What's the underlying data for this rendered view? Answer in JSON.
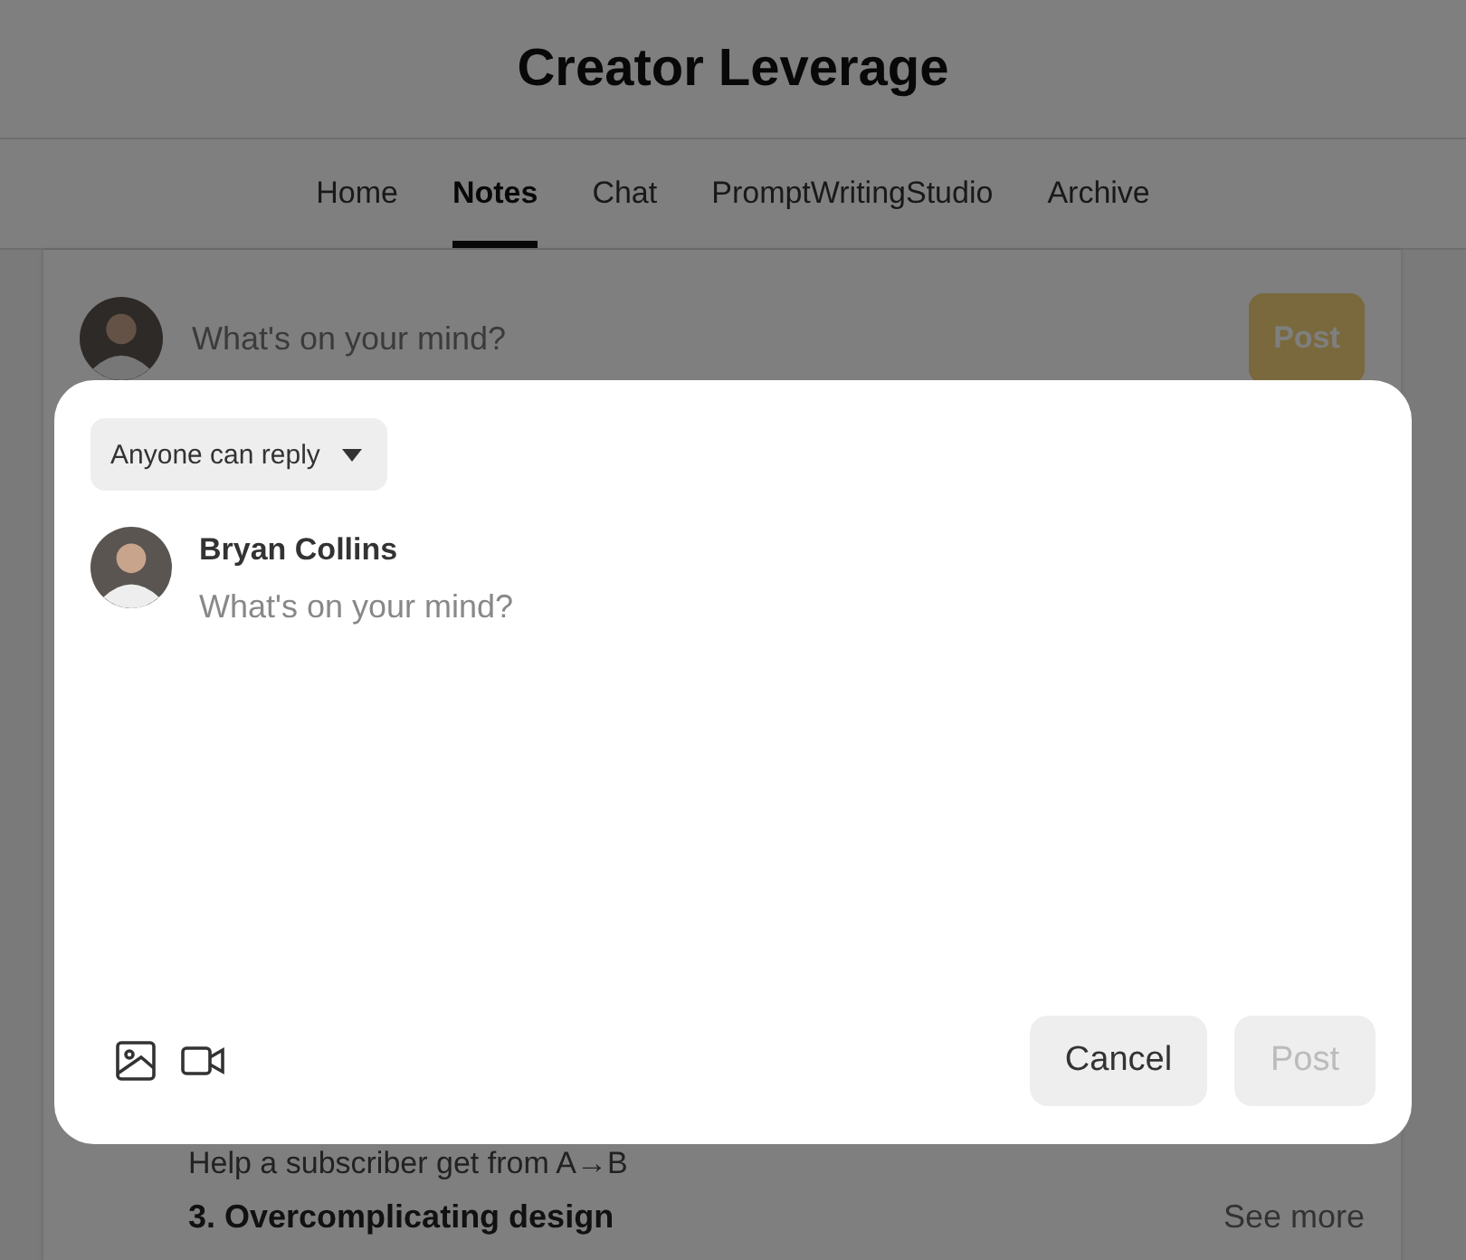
{
  "header": {
    "title": "Creator Leverage"
  },
  "tabs": [
    {
      "label": "Home",
      "selected": false
    },
    {
      "label": "Notes",
      "selected": true
    },
    {
      "label": "Chat",
      "selected": false
    },
    {
      "label": "PromptWritingStudio",
      "selected": false
    },
    {
      "label": "Archive",
      "selected": false
    }
  ],
  "composer": {
    "placeholder": "What's on your mind?",
    "post_button": "Post"
  },
  "feed": {
    "lines": [
      {
        "kind": "plain",
        "text": "Help a subscriber get from A→B"
      },
      {
        "kind": "heading",
        "text": "3. Overcomplicating design"
      }
    ],
    "see_more": "See more"
  },
  "modal": {
    "audience": "Anyone can reply",
    "author": "Bryan Collins",
    "placeholder": "What's on your mind?",
    "cancel_button": "Cancel",
    "post_button": {
      "label": "Post",
      "disabled": true
    }
  }
}
